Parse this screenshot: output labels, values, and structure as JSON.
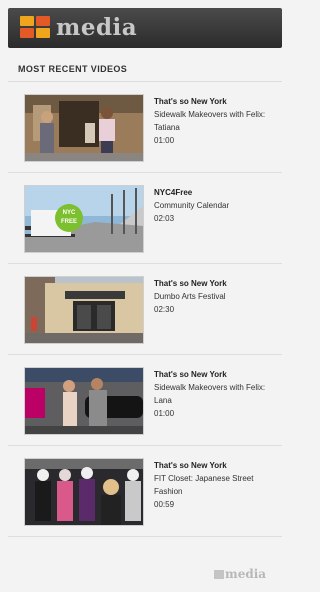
{
  "header": {
    "brand_mark": "NYC",
    "brand_word": "media"
  },
  "section": {
    "title": "MOST RECENT VIDEOS"
  },
  "videos": [
    {
      "show": "That's so New York",
      "title": "Sidewalk Makeovers with Felix: Tatiana",
      "duration": "01:00",
      "thumbnail": "street-makeover-scene"
    },
    {
      "show": "NYC4Free",
      "title": "Community Calendar",
      "duration": "02:03",
      "thumbnail": "nyc-free-badge-on-pier",
      "badge": "NYC FREE"
    },
    {
      "show": "That's so New York",
      "title": "Dumbo Arts Festival",
      "duration": "02:30",
      "thumbnail": "dumbo-building"
    },
    {
      "show": "That's so New York",
      "title": "Sidewalk Makeovers with Felix: Lana",
      "duration": "01:00",
      "thumbnail": "street-makeover-car"
    },
    {
      "show": "That's so New York",
      "title": "FIT Closet: Japanese Street Fashion",
      "duration": "00:59",
      "thumbnail": "fashion-closet"
    }
  ],
  "footer": {
    "brand": "media"
  },
  "colors": {
    "header_dark": "#2b2b2b",
    "logo_orange": "#f0a61c",
    "logo_red": "#e35a26",
    "badge_green": "#7cbf2f"
  }
}
